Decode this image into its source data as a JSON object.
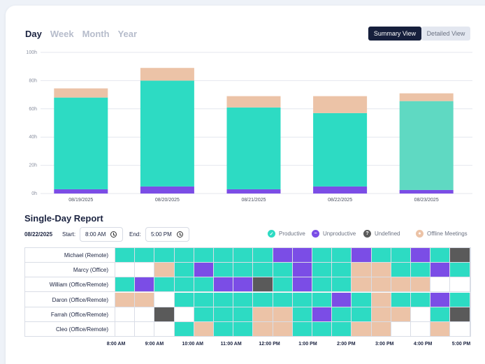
{
  "tabs": [
    "Day",
    "Week",
    "Month",
    "Year"
  ],
  "active_tab": 0,
  "view_toggle": {
    "summary_label": "Summary View",
    "detailed_label": "Detailed View"
  },
  "colors": {
    "productive": "#2ddbc3",
    "productive_alt": "#5fd9c2",
    "unproductive": "#7b4de6",
    "undefined": "#5a5a5a",
    "offline": "#ecc3a7",
    "empty": "#ffffff"
  },
  "chart_data": {
    "type": "bar",
    "stacked": true,
    "categories": [
      "08/19/2025",
      "08/20/2025",
      "08/21/2025",
      "08/22/2025",
      "08/23/2025"
    ],
    "y_ticks": [
      "0h",
      "20h",
      "40h",
      "60h",
      "80h",
      "100h"
    ],
    "ylim": [
      0,
      100
    ],
    "series": [
      {
        "key": "unproductive",
        "values": [
          3,
          5,
          3,
          5,
          2.5
        ]
      },
      {
        "key": "productive",
        "values": [
          65,
          75,
          58,
          52,
          63
        ]
      },
      {
        "key": "offline",
        "values": [
          6.5,
          9,
          8,
          12,
          5.5
        ]
      }
    ],
    "grid": true
  },
  "report": {
    "title": "Single-Day Report",
    "date": "08/22/2025",
    "start_label": "Start:",
    "start_value": "8:00 AM",
    "end_label": "End:",
    "end_value": "5:00 PM",
    "legend": [
      {
        "label": "Productive",
        "key": "productive",
        "icon": "check-icon"
      },
      {
        "label": "Unproductive",
        "key": "unproductive",
        "icon": "minus-icon"
      },
      {
        "label": "Undefined",
        "key": "undefined",
        "icon": "question-icon"
      },
      {
        "label": "Offline Meetings",
        "key": "offline",
        "icon": "meeting-icon"
      }
    ],
    "time_axis": [
      "8:00 AM",
      "9:00 AM",
      "10:00 AM",
      "11:00 AM",
      "12:00 PM",
      "1:00 PM",
      "2:00 PM",
      "3:00 PM",
      "4:00 PM",
      "5:00 PM"
    ],
    "rows": [
      {
        "name": "Michael (Remote)",
        "slots": [
          "P",
          "P",
          "P",
          "P",
          "P",
          "P",
          "P",
          "P",
          "U",
          "U",
          "P",
          "P",
          "U",
          "P",
          "P",
          "U",
          "P",
          "X"
        ]
      },
      {
        "name": "Marcy (Office)",
        "slots": [
          "E",
          "E",
          "O",
          "P",
          "U",
          "P",
          "P",
          "P",
          "P",
          "U",
          "P",
          "P",
          "O",
          "O",
          "P",
          "P",
          "U",
          "P"
        ]
      },
      {
        "name": "William (Office/Remote)",
        "slots": [
          "P",
          "U",
          "P",
          "P",
          "P",
          "U",
          "U",
          "X",
          "P",
          "U",
          "P",
          "P",
          "O",
          "O",
          "O",
          "O",
          "E",
          "E"
        ]
      },
      {
        "name": "Daron (Office/Remote)",
        "slots": [
          "O",
          "O",
          "E",
          "P",
          "P",
          "P",
          "P",
          "P",
          "P",
          "P",
          "P",
          "U",
          "P",
          "O",
          "P",
          "P",
          "U",
          "P"
        ]
      },
      {
        "name": "Farrah (Office/Remote)",
        "slots": [
          "E",
          "E",
          "X",
          "E",
          "P",
          "P",
          "P",
          "O",
          "O",
          "P",
          "U",
          "P",
          "P",
          "O",
          "O",
          "E",
          "P",
          "X"
        ]
      },
      {
        "name": "Cleo (Office/Remote)",
        "slots": [
          "E",
          "E",
          "E",
          "P",
          "O",
          "P",
          "P",
          "O",
          "O",
          "P",
          "P",
          "P",
          "O",
          "O",
          "E",
          "E",
          "O",
          "E"
        ]
      }
    ]
  }
}
